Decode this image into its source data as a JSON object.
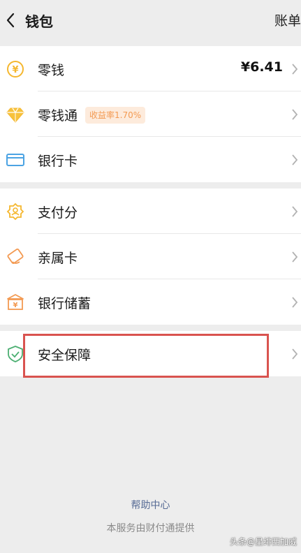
{
  "header": {
    "title": "钱包",
    "bill_label": "账单"
  },
  "group1": [
    {
      "label": "零钱",
      "amount": "¥6.41",
      "icon": "yuan-coin-icon"
    },
    {
      "label": "零钱通",
      "badge": "收益率1.70%",
      "icon": "diamond-icon"
    },
    {
      "label": "银行卡",
      "icon": "card-icon"
    }
  ],
  "group2": [
    {
      "label": "支付分",
      "icon": "pay-score-icon"
    },
    {
      "label": "亲属卡",
      "icon": "family-card-icon"
    },
    {
      "label": "银行储蓄",
      "icon": "bank-savings-icon"
    }
  ],
  "group3": [
    {
      "label": "安全保障",
      "icon": "shield-icon"
    }
  ],
  "footer": {
    "help": "帮助中心",
    "provider": "本服务由财付通提供"
  },
  "watermark": "头条@星绯西加威",
  "colors": {
    "background": "#ededed",
    "link": "#576b95",
    "badge_text": "#f39a52",
    "badge_bg": "#fdebdc",
    "highlight": "#d9534f",
    "shield": "#4caf72",
    "card": "#4ba3e3",
    "gold": "#f5b72e",
    "orange": "#f39a52"
  }
}
